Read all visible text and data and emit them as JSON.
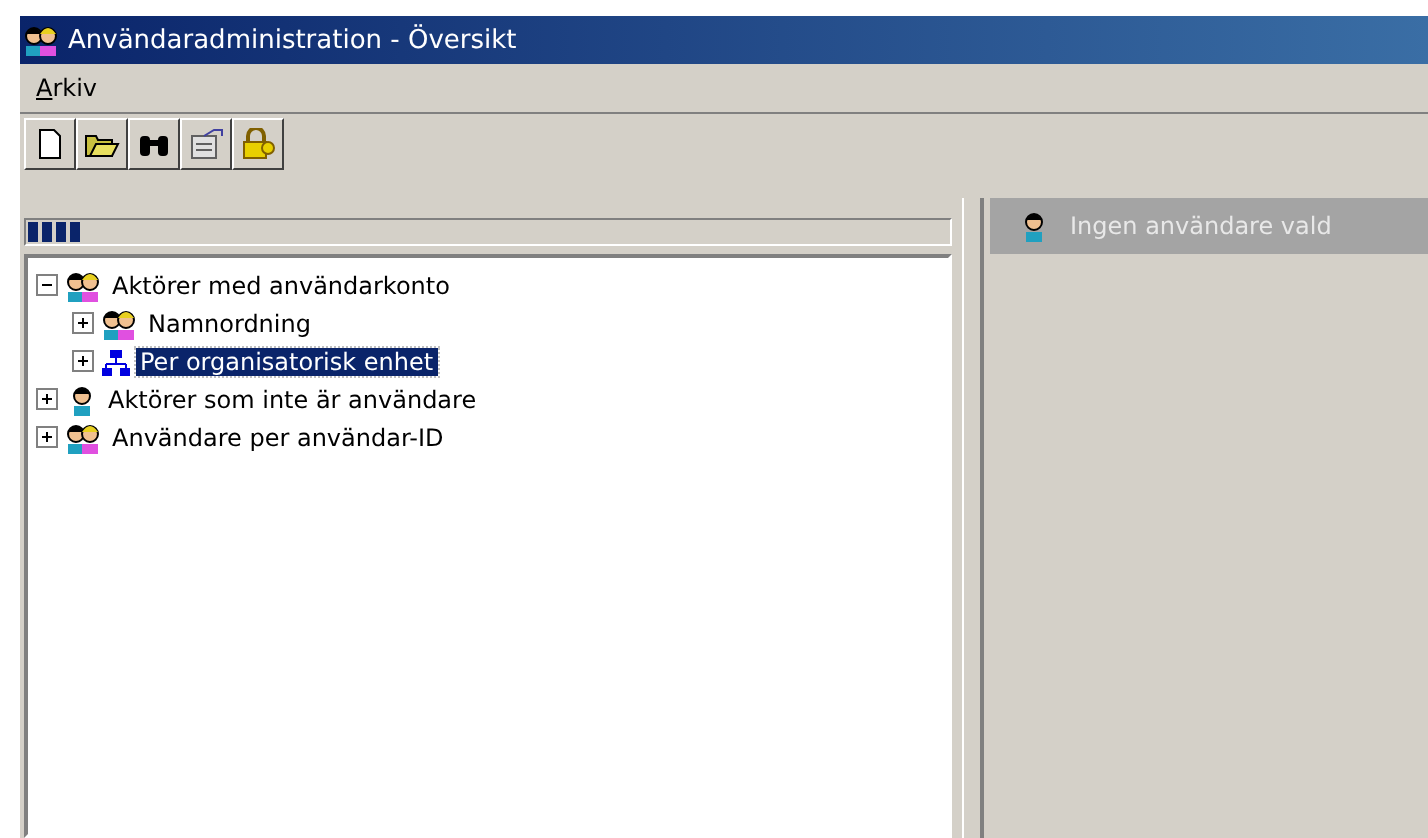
{
  "window": {
    "title": "Användaradministration - Översikt"
  },
  "menu": [
    {
      "label": "Arkiv"
    }
  ],
  "toolbar": [
    {
      "kind": "new"
    },
    {
      "kind": "open"
    },
    {
      "kind": "find"
    },
    {
      "kind": "properties"
    },
    {
      "kind": "lock"
    }
  ],
  "progress": {
    "level": 0.06
  },
  "tree": [
    {
      "label": "Aktörer med användarkonto",
      "kind": "people",
      "expanded": true,
      "selected": false,
      "children": [
        {
          "label": "Namnordning",
          "kind": "people",
          "expanded": false,
          "selected": false
        },
        {
          "label": "Per organisatorisk enhet",
          "kind": "org",
          "expanded": false,
          "selected": true
        }
      ]
    },
    {
      "label": "Aktörer som inte är användare",
      "kind": "person",
      "expanded": false,
      "selected": false
    },
    {
      "label": "Användare per användar-ID",
      "kind": "people",
      "expanded": false,
      "selected": false
    }
  ],
  "detail": {
    "header": "Ingen användare vald"
  }
}
